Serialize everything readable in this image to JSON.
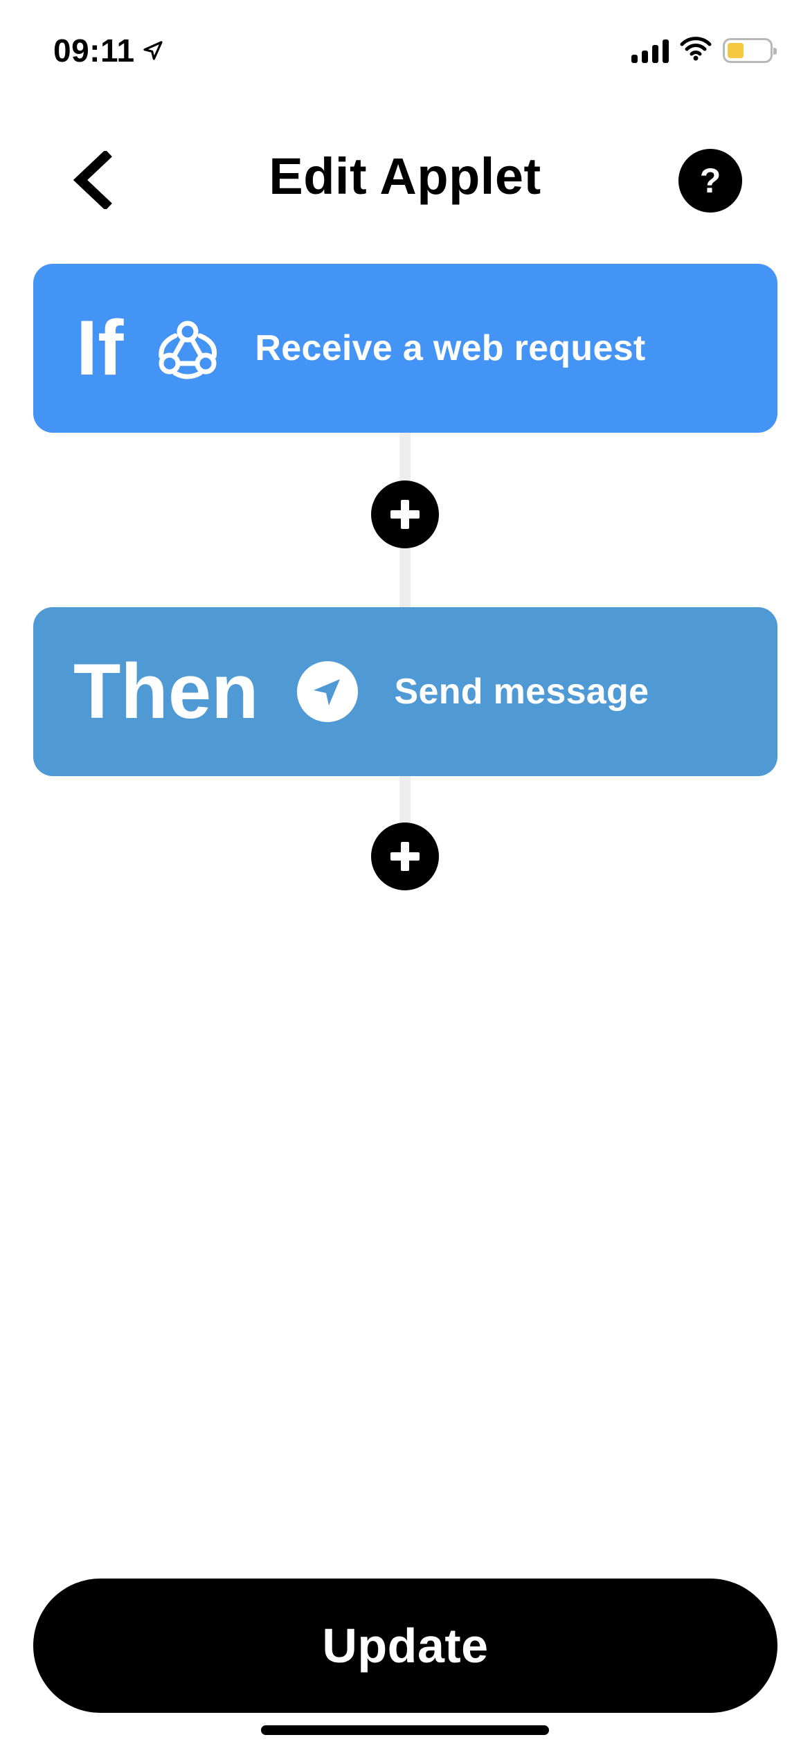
{
  "status_bar": {
    "time": "09:11",
    "location_icon": "location-arrow-icon",
    "signal_icon": "cellular-signal-icon",
    "wifi_icon": "wifi-icon",
    "battery_icon": "battery-icon",
    "battery_level": 0.4,
    "battery_color": "#f5c842"
  },
  "header": {
    "title": "Edit Applet",
    "back_icon": "chevron-left-icon",
    "help_label": "?"
  },
  "trigger": {
    "keyword": "If",
    "icon": "webhook-icon",
    "label": "Receive a web request",
    "color": "#4494f6"
  },
  "action": {
    "keyword": "Then",
    "icon": "send-arrow-icon",
    "label": "Send message",
    "color": "#4f9ad4"
  },
  "add_icon": "plus-icon",
  "footer": {
    "update_label": "Update"
  }
}
